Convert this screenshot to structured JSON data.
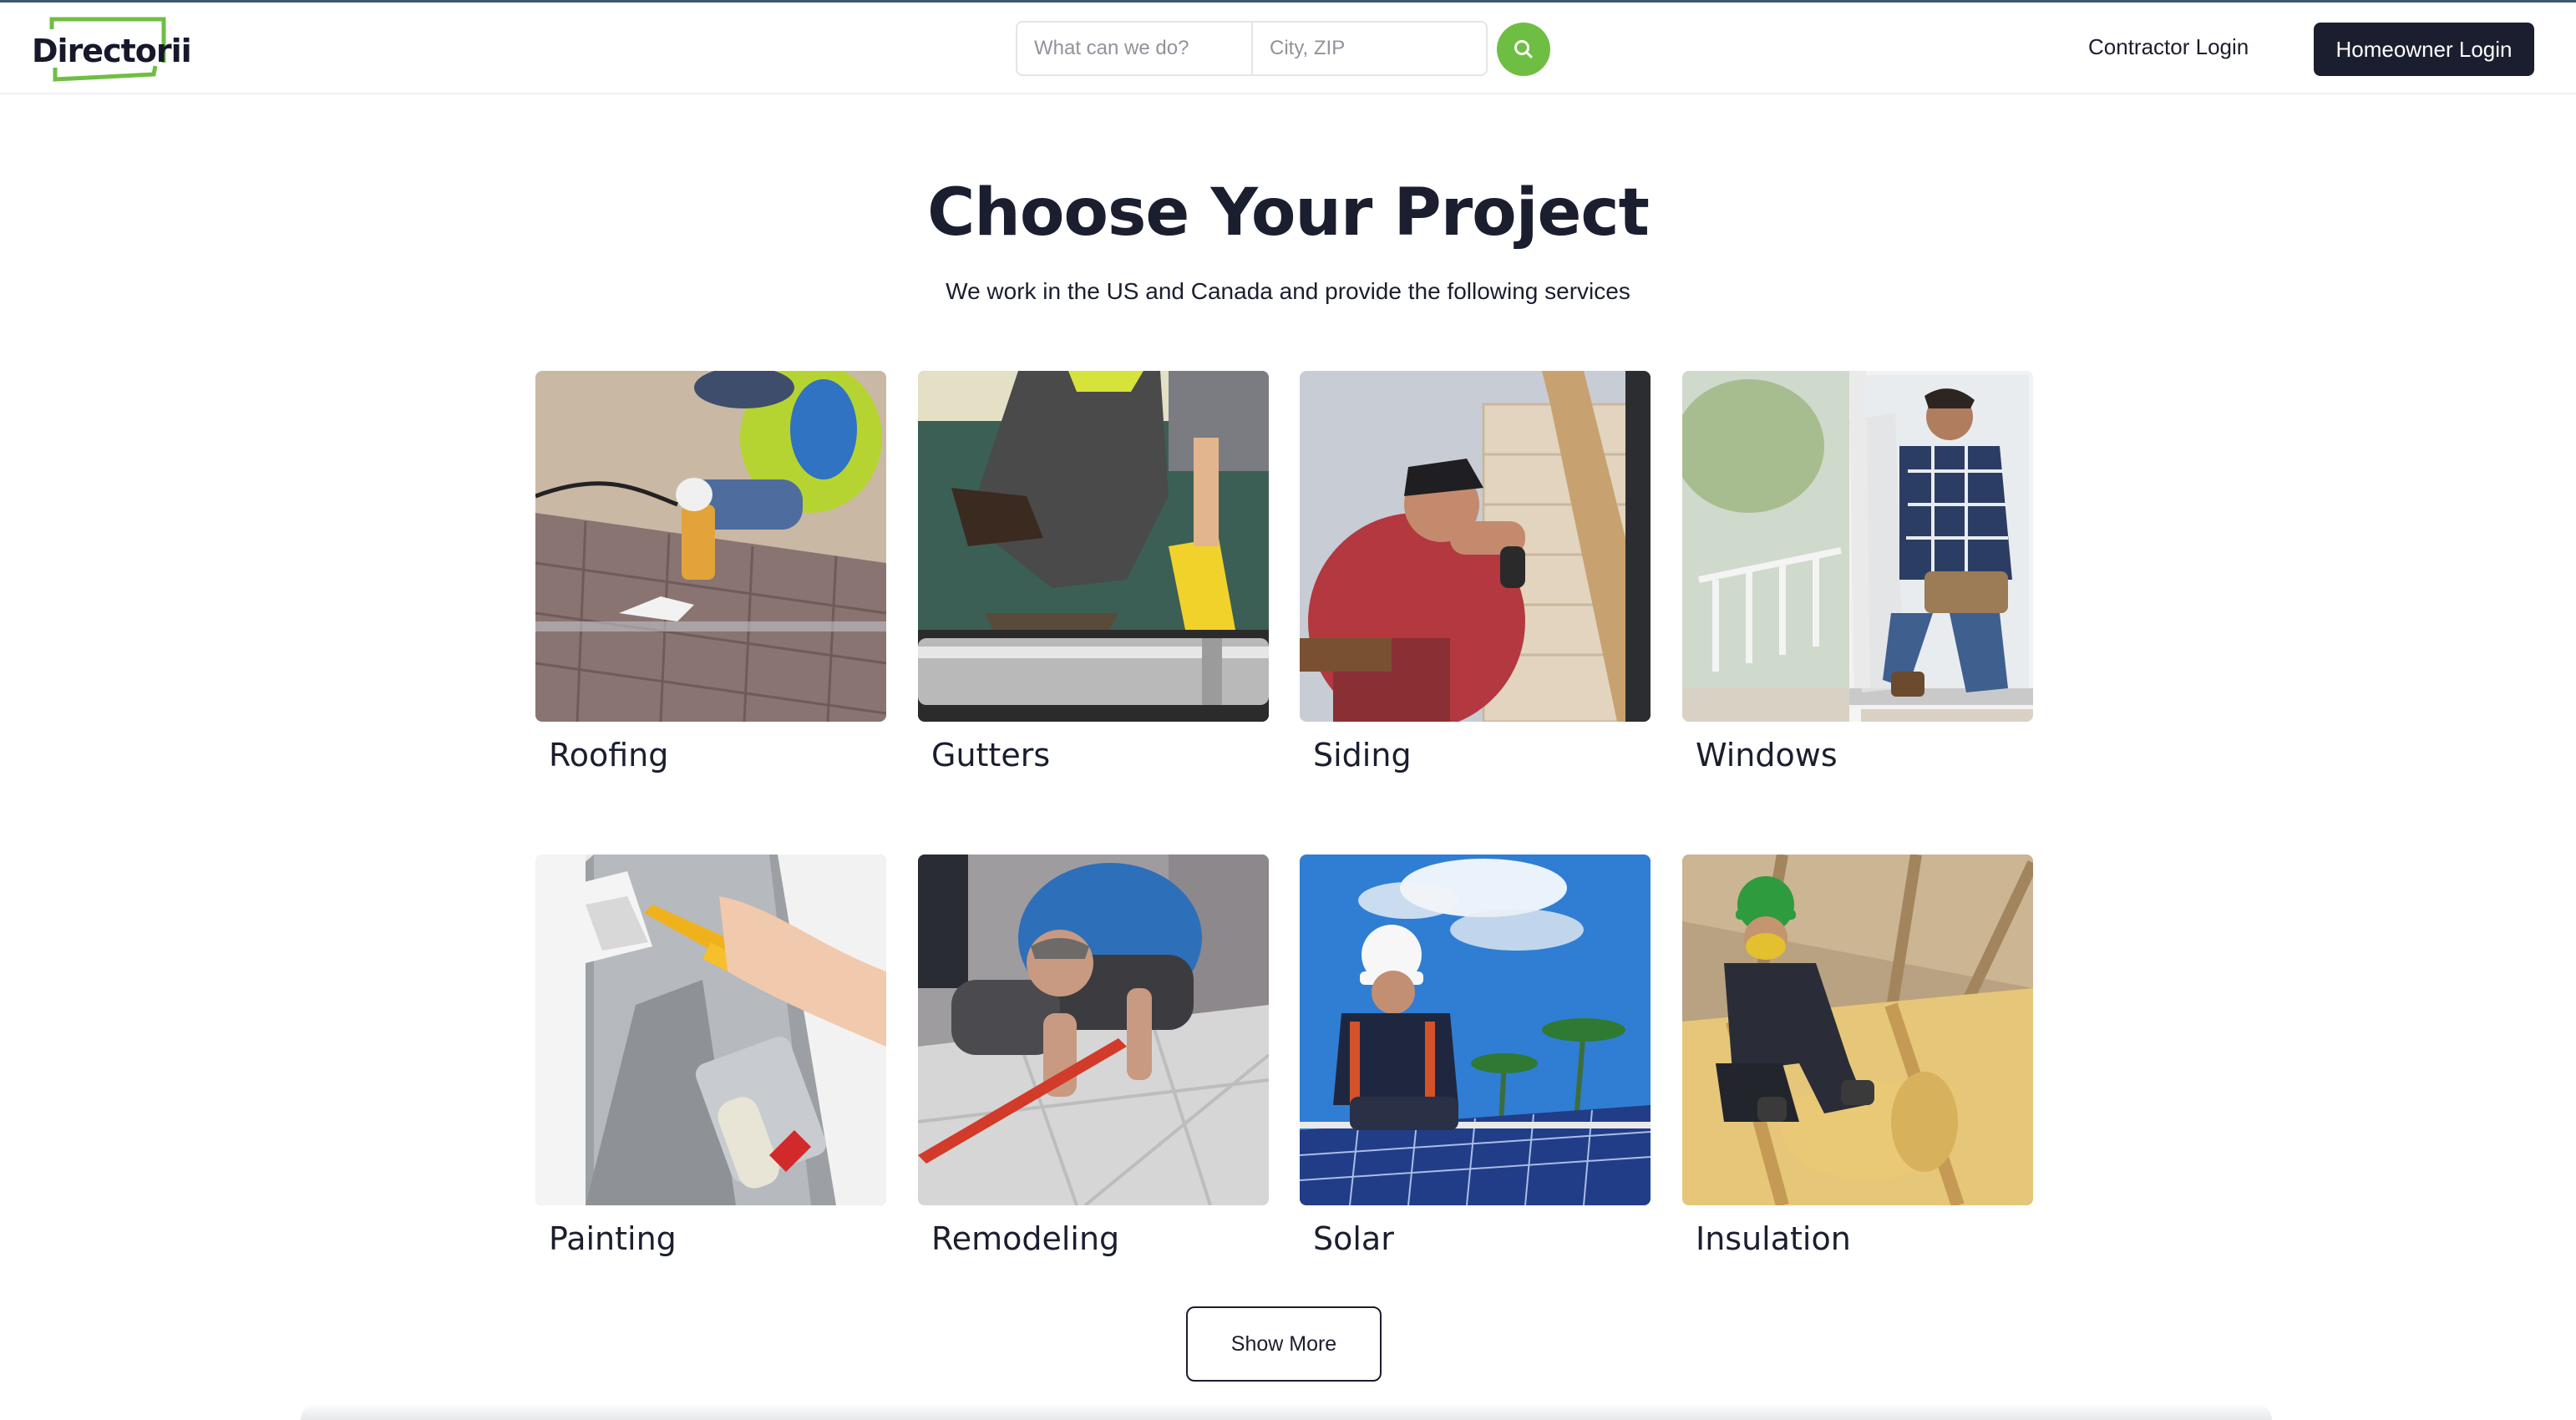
{
  "header": {
    "logo_text": "Directorii",
    "search_what_placeholder": "What can we do?",
    "search_where_placeholder": "City, ZIP",
    "search_icon": "search-icon",
    "contractor_login": "Contractor Login",
    "homeowner_login": "Homeowner Login"
  },
  "main": {
    "title": "Choose Your Project",
    "subtitle": "We work in the US and Canada and provide the following services",
    "projects": [
      {
        "label": "Roofing"
      },
      {
        "label": "Gutters"
      },
      {
        "label": "Siding"
      },
      {
        "label": "Windows"
      },
      {
        "label": "Painting"
      },
      {
        "label": "Remodeling"
      },
      {
        "label": "Solar"
      },
      {
        "label": "Insulation"
      }
    ],
    "show_more": "Show More"
  },
  "colors": {
    "brand_green": "#6fbe44",
    "dark_navy": "#1b1e2e"
  }
}
